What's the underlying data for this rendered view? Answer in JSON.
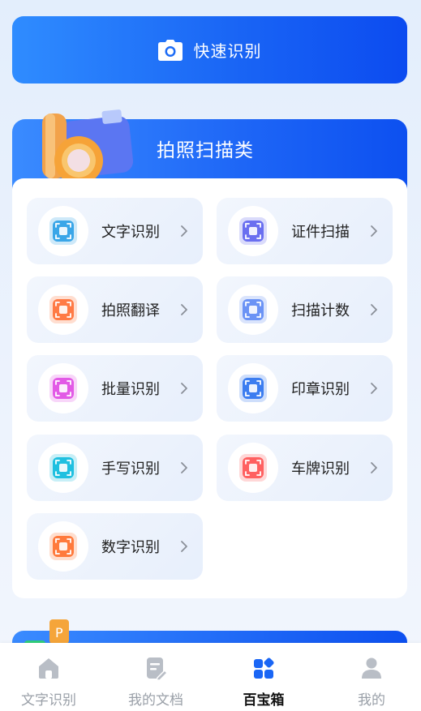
{
  "quick": {
    "label": "快速识别",
    "icon": "camera-icon"
  },
  "section": {
    "title": "拍照扫描类"
  },
  "tools": [
    {
      "label": "文字识别",
      "icon": "text-ocr-icon",
      "color": "#3aa6e8"
    },
    {
      "label": "证件扫描",
      "icon": "id-card-icon",
      "color": "#6a6ff0"
    },
    {
      "label": "拍照翻译",
      "icon": "photo-translate-icon",
      "color": "#ff7a45"
    },
    {
      "label": "扫描计数",
      "icon": "scan-count-icon",
      "color": "#6b93f5"
    },
    {
      "label": "批量识别",
      "icon": "batch-ocr-icon",
      "color": "#e25ae6"
    },
    {
      "label": "印章识别",
      "icon": "seal-icon",
      "color": "#3c7df0"
    },
    {
      "label": "手写识别",
      "icon": "handwriting-icon",
      "color": "#1fc0e0"
    },
    {
      "label": "车牌识别",
      "icon": "license-plate-icon",
      "color": "#ff6060"
    },
    {
      "label": "数字识别",
      "icon": "digit-icon",
      "color": "#ff7a3c"
    }
  ],
  "tabs": [
    {
      "label": "文字识别",
      "icon": "home-icon",
      "active": false
    },
    {
      "label": "我的文档",
      "icon": "document-icon",
      "active": false
    },
    {
      "label": "百宝箱",
      "icon": "toolbox-icon",
      "active": true
    },
    {
      "label": "我的",
      "icon": "user-icon",
      "active": false
    }
  ],
  "colors": {
    "primary": "#1a66f5",
    "tab_inactive": "#9aa0a8",
    "tab_active": "#111111"
  }
}
